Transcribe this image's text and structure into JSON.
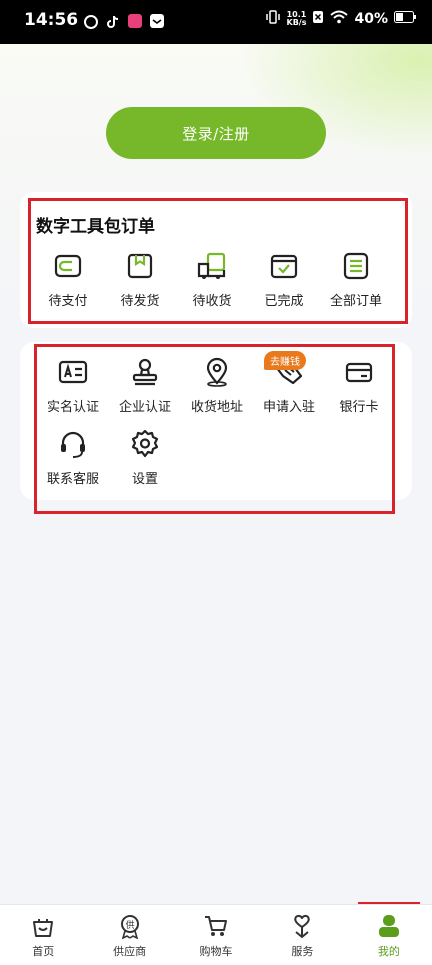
{
  "status_bar": {
    "time": "14:56",
    "net_speed_top": "10.1",
    "net_speed_unit": "KB/s",
    "battery": "40%"
  },
  "login": {
    "label": "登录/注册"
  },
  "orders": {
    "title": "数字工具包订单",
    "items": [
      {
        "label": "待支付",
        "icon": "wallet-icon"
      },
      {
        "label": "待发货",
        "icon": "package-icon"
      },
      {
        "label": "待收货",
        "icon": "truck-icon"
      },
      {
        "label": "已完成",
        "icon": "check-calendar-icon"
      },
      {
        "label": "全部订单",
        "icon": "list-icon"
      }
    ]
  },
  "services": {
    "badge": "去赚钱",
    "items": [
      {
        "label": "实名认证",
        "icon": "id-card-icon"
      },
      {
        "label": "企业认证",
        "icon": "stamp-icon"
      },
      {
        "label": "收货地址",
        "icon": "location-pin-icon"
      },
      {
        "label": "申请入驻",
        "icon": "handshake-icon"
      },
      {
        "label": "银行卡",
        "icon": "bank-card-icon"
      },
      {
        "label": "联系客服",
        "icon": "headset-icon"
      },
      {
        "label": "设置",
        "icon": "gear-icon"
      }
    ]
  },
  "bottom_nav": {
    "items": [
      {
        "label": "首页",
        "icon": "home-basket-icon"
      },
      {
        "label": "供应商",
        "icon": "supplier-badge-icon"
      },
      {
        "label": "购物车",
        "icon": "cart-icon"
      },
      {
        "label": "服务",
        "icon": "heart-hand-icon"
      },
      {
        "label": "我的",
        "icon": "user-icon",
        "active": true
      }
    ]
  },
  "colors": {
    "accent": "#76b82a",
    "accent_dark": "#5a9e1b",
    "badge": "#e8791d",
    "annotation": "#d8232a"
  }
}
